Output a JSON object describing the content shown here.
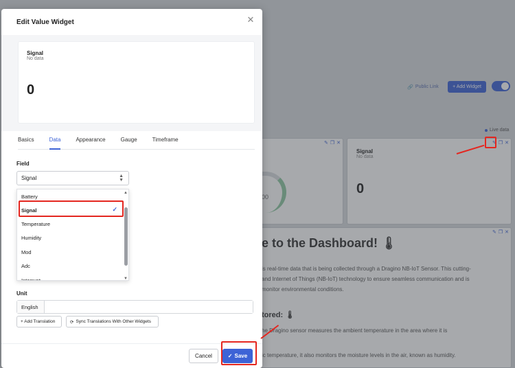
{
  "background": {
    "public_link": "Public Link",
    "add_widget": "+ Add Widget",
    "live_data": "Live data",
    "gauge_value": "00",
    "signal_title": "Signal",
    "signal_sub": "No data",
    "signal_value": "0",
    "welcome": "e to the Dashboard! 🌡",
    "para1": "is real-time data that is being collected through a Dragino NB-IoT Sensor. This cutting-",
    "para2": "and Internet of Things (NB-IoT) technology to ensure seamless communication and is",
    "para3": "monitor environmental conditions.",
    "subheading": "tored: 🌡",
    "para4": "he Dragino sensor measures the ambient temperature in the area where it is",
    "para5": "ic temperature, it also monitors the moisture levels in the air, known as humidity."
  },
  "modal": {
    "title": "Edit Value Widget",
    "close_icon": "✕",
    "preview": {
      "title": "Signal",
      "subtitle": "No data",
      "value": "0"
    },
    "tabs": [
      "Basics",
      "Data",
      "Appearance",
      "Gauge",
      "Timeframe"
    ],
    "active_tab": "Data",
    "field_label": "Field",
    "field_value": "Signal",
    "dropdown_options": [
      "Battery",
      "Signal",
      "Temperature",
      "Humidity",
      "Mod",
      "Adc",
      "Interrupt"
    ],
    "selected_option": "Signal",
    "unit_label": "Unit",
    "unit_language": "English",
    "unit_value": "",
    "add_translation": "+ Add Translation",
    "sync_translations": "Sync Translations With Other Widgets",
    "cancel": "Cancel",
    "save": "Save"
  },
  "colors": {
    "accent": "#3d63d6",
    "annotation": "#e4261f"
  }
}
